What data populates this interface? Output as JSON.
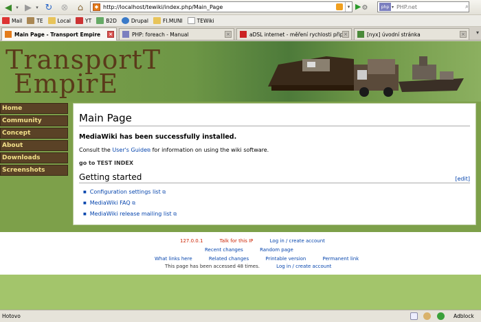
{
  "browser": {
    "url": "http://localhost/tewiki/index.php/Main_Page",
    "search_placeholder": "PHP.net",
    "search_engine_label": "php",
    "bookmarks": [
      {
        "label": "Mail",
        "color": "#d33"
      },
      {
        "label": "TE",
        "color": "#a85"
      },
      {
        "label": "Local",
        "color": "#e8c45a"
      },
      {
        "label": "YT",
        "color": "#c33"
      },
      {
        "label": "B2D",
        "color": "#6a6"
      },
      {
        "label": "Drupal",
        "color": "#3a7ac8"
      },
      {
        "label": "FI.MUNI",
        "color": "#e8c45a"
      },
      {
        "label": "TEWiki",
        "color": "#ddd"
      }
    ],
    "tabs": [
      {
        "label": "Main Page - Transport Empire",
        "active": true
      },
      {
        "label": "PHP: foreach - Manual",
        "active": false
      },
      {
        "label": "aDSL internet - měření rychlosti připoj...",
        "active": false
      },
      {
        "label": "[nyx] úvodní stránka",
        "active": false
      }
    ],
    "status": "Hotovo",
    "adblock_label": "Adblock"
  },
  "site": {
    "logo_line1": "TransportT",
    "logo_line2": "EmpirE",
    "nav": [
      "Home",
      "Community",
      "Concept",
      "About",
      "Downloads",
      "Screenshots"
    ]
  },
  "article": {
    "title": "Main Page",
    "installed": "MediaWiki has been successfully installed.",
    "consult_pre": "Consult the",
    "users_guide": "User's Guide",
    "consult_post": "for information on using the wiki software.",
    "goto": "go to TEST INDEX",
    "section": "Getting started",
    "edit": "[edit]",
    "links": [
      "Configuration settings list",
      "MediaWiki FAQ",
      "MediaWiki release mailing list"
    ]
  },
  "footer": {
    "ip": "127.0.0.1",
    "talk": "Talk for this IP",
    "login": "Log in / create account",
    "recent": "Recent changes",
    "random": "Random page",
    "what_links": "What links here",
    "related": "Related changes",
    "printable": "Printable version",
    "permanent": "Permanent link",
    "accessed": "This page has been accessed 48 times.",
    "login2": "Log in / create account"
  }
}
